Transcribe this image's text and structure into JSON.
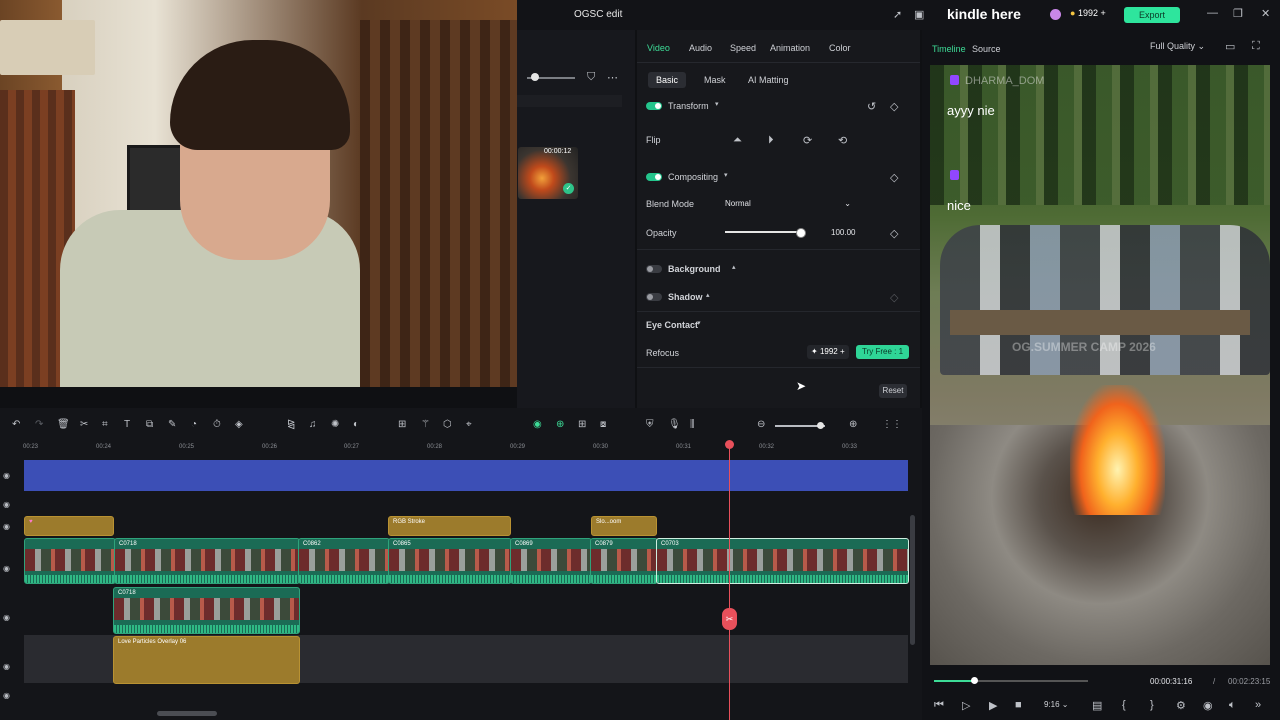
{
  "window": {
    "title": "OGSC edit",
    "credits": "1992",
    "export_label": "Export"
  },
  "overlay_caption": "kindle here",
  "webcam": {
    "description_hidden": ""
  },
  "media": {
    "thumb_duration": "00:00:12"
  },
  "properties": {
    "tabs": [
      "Video",
      "Audio",
      "Speed",
      "Animation",
      "Color"
    ],
    "active_tab": "Video",
    "subtabs": [
      "Basic",
      "Mask",
      "AI Matting"
    ],
    "active_subtab": "Basic",
    "transform_label": "Transform",
    "flip_label": "Flip",
    "compositing_label": "Compositing",
    "blend_mode_label": "Blend Mode",
    "blend_mode_value": "Normal",
    "opacity_label": "Opacity",
    "opacity_value": "100.00",
    "opacity_fraction": 1.0,
    "background_label": "Background",
    "shadow_label": "Shadow",
    "eye_contact_label": "Eye Contact",
    "refocus_label": "Refocus",
    "refocus_credits": "1992",
    "try_free_label": "Try Free : 1",
    "reset_label": "Reset"
  },
  "preview": {
    "tabs": [
      "Timeline",
      "Source"
    ],
    "active_tab": "Timeline",
    "quality_label": "Full Quality",
    "chat": [
      {
        "user": "DHARMA_DOM",
        "message": "ayyy nie"
      },
      {
        "user": "",
        "message": "nice"
      }
    ],
    "watermark": "OG.SUMMER CAMP 2026",
    "current_time": "00:00:31:16",
    "separator": "/",
    "total_time": "00:02:23:15",
    "ratio_label": "9:16",
    "progress_fraction": 0.22
  },
  "timeline": {
    "ruler": [
      "00:23",
      "00:24",
      "00:25",
      "00:26",
      "00:27",
      "00:28",
      "00:29",
      "00:30",
      "00:31",
      "00:32",
      "00:33"
    ],
    "clips": {
      "rgb_stroke": "RGB Stroke",
      "slo_zoom": "Slo...oom",
      "c0718": "C0718",
      "c0862": "C0862",
      "c0865": "C0865",
      "c0869": "C0869",
      "c0879": "C0879",
      "c0703": "C0703",
      "c0718b": "C0718",
      "love_particles": "Love Particles Overlay 06"
    }
  },
  "colors": {
    "accent": "#3ddc97",
    "playhead": "#e8505b",
    "export": "#2ee59d"
  }
}
